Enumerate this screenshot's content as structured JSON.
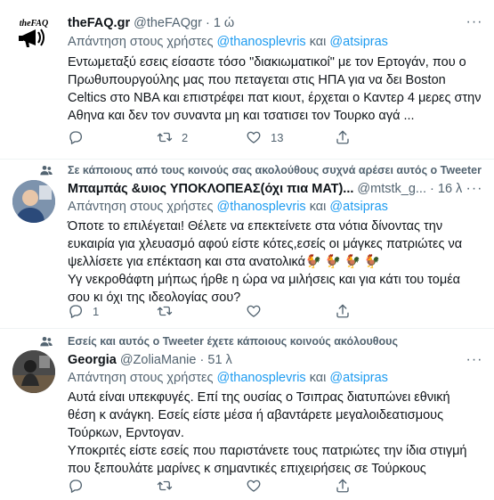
{
  "tweets": [
    {
      "name": "theFAQ.gr",
      "handle": "@theFAQgr",
      "time": "1 ώ",
      "reply_prefix": "Απάντηση στους χρήστες",
      "reply_user1": "@thanosplevris",
      "reply_and": "και",
      "reply_user2": "@atsipras",
      "text": "Εντωμεταξύ εσεις είσαστε τόσο \"διακιωματικοί\" με τον Ερτογάν, που ο Πρωθυπουργούλης μας που πεταγεται στις ΗΠΑ για να δει Boston Celtics στο NBA και επιστρέφει πατ κιουτ, έρχεται ο Καντερ 4 μερες στην Αθηνα και δεν τον συναντα μη και τσατισει τον Τουρκο αγά ...",
      "avatar_text": "theFAQ",
      "replies": "",
      "retweets": "2",
      "likes": "13"
    },
    {
      "social_context": "Σε κάποιους από τους κοινούς σας ακολούθους συχνά αρέσει αυτός ο Tweeter",
      "name": "Μπαμπάς &υιος ΥΠΟΚΛΟΠΕΑΣ(όχι πια ΜΑΤ)...",
      "handle": "@mtstk_g...",
      "time": "16 λ",
      "reply_prefix": "Απάντηση στους χρήστες",
      "reply_user1": "@thanosplevris",
      "reply_and": "και",
      "reply_user2": "@atsipras",
      "text1": "Όποτε το επιλέγεται! Θέλετε να επεκτείνετε στα νότια δίνοντας την ευκαιρία για χλευασμό αφού είστε κότες,εσείς οι μάγκες πατριώτες να ψελλίσετε για επέκταση και στα ανατολικά🐓 🐓 🐓 🐓",
      "text2": "Υγ νεκροθάφτη μήπως ήρθε η ώρα να μιλήσεις και για κάτι του τομέα σου κι όχι της ιδεολογίας σου?",
      "replies": "1",
      "retweets": "",
      "likes": ""
    },
    {
      "social_context": "Εσείς και αυτός ο Tweeter έχετε κάποιους κοινούς ακόλουθους",
      "name": "Georgia",
      "handle": "@ZoliaManie",
      "time": "51 λ",
      "reply_prefix": "Απάντηση στους χρήστες",
      "reply_user1": "@thanosplevris",
      "reply_and": "και",
      "reply_user2": "@atsipras",
      "text1": "Αυτά είναι υπεκφυγές. Επί της ουσίας ο Τσιπρας διατυπώνει εθνική θέση κ ανάγκη. Εσείς είστε μέσα ή αβαντάρετε μεγαλοιδεατισμους Τούρκων, Ερντογαν.",
      "text2": "Υποκριτές είστε εσείς που παριστάνετε τους πατριώτες την ίδια στιγμή που ξεπουλάτε μαρίνες κ σημαντικές επιχειρήσεις σε Τούρκους",
      "replies": "",
      "retweets": "",
      "likes": ""
    }
  ],
  "colors": {
    "accent": "#1d9bf0",
    "muted": "#536471",
    "text": "#0f1419",
    "divider": "#eff3f4"
  },
  "icons": [
    "reply-icon",
    "retweet-icon",
    "like-icon",
    "share-icon",
    "more-icon",
    "people-icon"
  ]
}
